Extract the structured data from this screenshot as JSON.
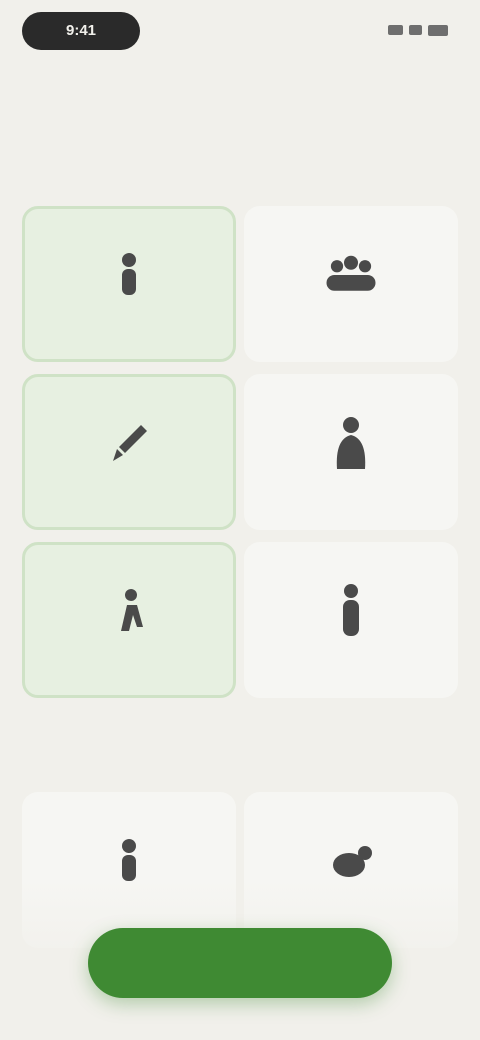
{
  "status_bar": {
    "time": "9:41",
    "icons": [
      "signal-icon",
      "wifi-icon",
      "battery-icon"
    ]
  },
  "header": {
    "title": "",
    "subtitle": ""
  },
  "activities": [
    {
      "label": "",
      "icon": "person-icon",
      "selected": true
    },
    {
      "label": "",
      "icon": "group-icon",
      "selected": false
    },
    {
      "label": "",
      "icon": "paint-icon",
      "selected": true
    },
    {
      "label": "",
      "icon": "figure-icon",
      "selected": false
    },
    {
      "label": "",
      "icon": "climbing-icon",
      "selected": true
    },
    {
      "label": "",
      "icon": "standing-icon",
      "selected": false
    }
  ],
  "more_section": {
    "label": "",
    "items": [
      {
        "label": "",
        "icon": "person-icon"
      },
      {
        "label": "",
        "icon": "pet-icon"
      }
    ]
  },
  "cta": {
    "label": ""
  },
  "colors": {
    "background": "#f1f0eb",
    "selected_card": "#e7f0e1",
    "selected_border": "#cfe2c6",
    "primary": "#3f8a33"
  }
}
